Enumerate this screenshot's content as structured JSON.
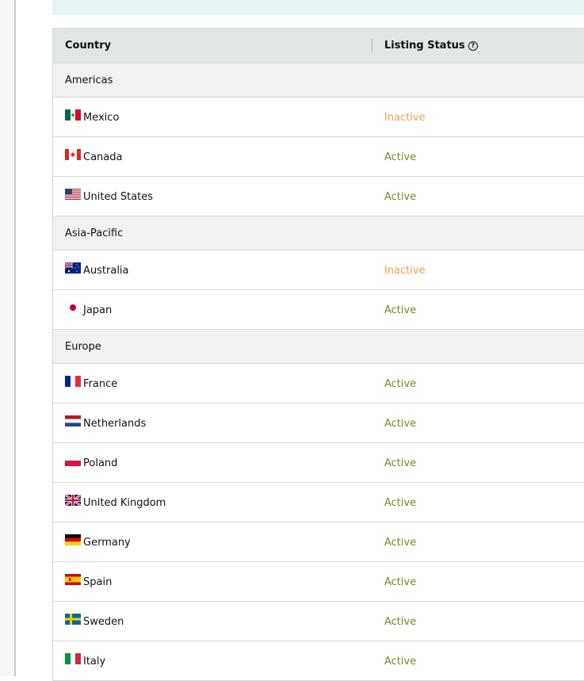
{
  "table": {
    "header": {
      "country": "Country",
      "listing_status": "Listing Status",
      "help_icon": "?"
    },
    "groups": [
      {
        "region": "Americas",
        "rows": [
          {
            "country": "Mexico",
            "status": "Inactive",
            "flag": "mexico-flag-icon"
          },
          {
            "country": "Canada",
            "status": "Active",
            "flag": "canada-flag-icon"
          },
          {
            "country": "United States",
            "status": "Active",
            "flag": "us-flag-icon"
          }
        ]
      },
      {
        "region": "Asia-Pacific",
        "rows": [
          {
            "country": "Australia",
            "status": "Inactive",
            "flag": "australia-flag-icon"
          },
          {
            "country": "Japan",
            "status": "Active",
            "flag": "japan-flag-icon"
          }
        ]
      },
      {
        "region": "Europe",
        "rows": [
          {
            "country": "France",
            "status": "Active",
            "flag": "france-flag-icon"
          },
          {
            "country": "Netherlands",
            "status": "Active",
            "flag": "netherlands-flag-icon"
          },
          {
            "country": "Poland",
            "status": "Active",
            "flag": "poland-flag-icon"
          },
          {
            "country": "United Kingdom",
            "status": "Active",
            "flag": "uk-flag-icon"
          },
          {
            "country": "Germany",
            "status": "Active",
            "flag": "germany-flag-icon"
          },
          {
            "country": "Spain",
            "status": "Active",
            "flag": "spain-flag-icon"
          },
          {
            "country": "Sweden",
            "status": "Active",
            "flag": "sweden-flag-icon"
          },
          {
            "country": "Italy",
            "status": "Active",
            "flag": "italy-flag-icon"
          }
        ]
      }
    ]
  },
  "colors": {
    "active": "#6b8e23",
    "inactive": "#f0a050",
    "header_bg": "#e3e6e6",
    "region_bg": "#f0f2f2"
  }
}
